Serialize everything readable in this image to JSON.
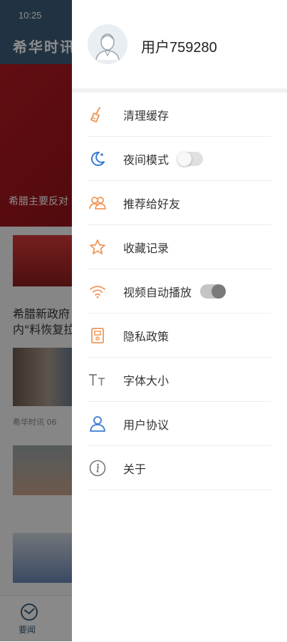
{
  "status_bar": {
    "time": "10:25"
  },
  "background": {
    "header_title": "希华时讯",
    "banner_caption": "希腊主要反对",
    "headline": "希腊新政府\n内\"料恢复拉",
    "meta": "希华时讯  06",
    "tab_label": "要闻"
  },
  "drawer": {
    "username": "用户759280",
    "menu": [
      {
        "label": "清理缓存",
        "icon": "broom-icon"
      },
      {
        "label": "夜间模式",
        "icon": "moon-icon",
        "toggle": false
      },
      {
        "label": "推荐给好友",
        "icon": "friends-icon"
      },
      {
        "label": "收藏记录",
        "icon": "star-icon"
      },
      {
        "label": "视频自动播放",
        "icon": "wifi-icon",
        "toggle": true
      },
      {
        "label": "隐私政策",
        "icon": "privacy-document-icon"
      },
      {
        "label": "字体大小",
        "icon": "font-size-icon"
      },
      {
        "label": "用户协议",
        "icon": "user-icon"
      },
      {
        "label": "关于",
        "icon": "info-icon"
      }
    ]
  },
  "colors": {
    "header_bg": "#3d5d78",
    "icon_orange": "#f0985a",
    "icon_blue": "#3a7bd5",
    "icon_gray": "#777777"
  }
}
